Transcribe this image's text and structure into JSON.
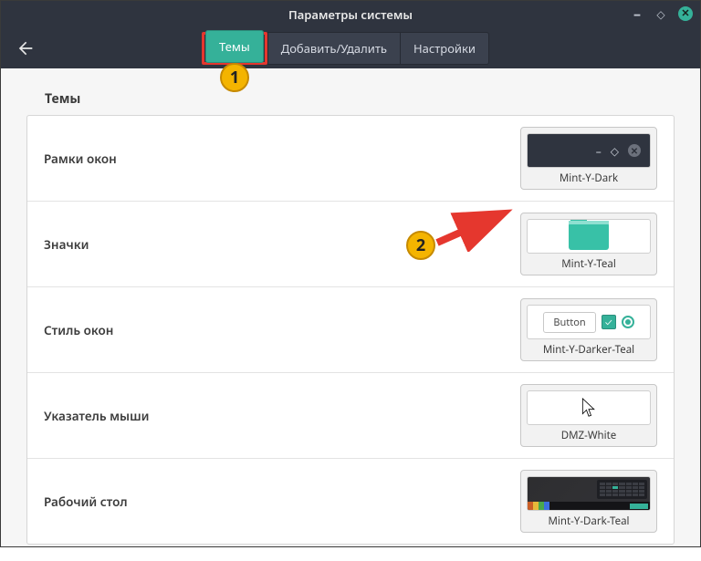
{
  "window": {
    "title": "Параметры системы"
  },
  "tabs": {
    "themes": "Темы",
    "add_remove": "Добавить/Удалить",
    "settings": "Настройки",
    "active": "themes"
  },
  "section": {
    "title": "Темы"
  },
  "rows": {
    "borders": {
      "label": "Рамки окон",
      "value": "Mint-Y-Dark"
    },
    "icons": {
      "label": "Значки",
      "value": "Mint-Y-Teal"
    },
    "controls": {
      "label": "Стиль окон",
      "value": "Mint-Y-Darker-Teal",
      "button_label": "Button"
    },
    "cursor": {
      "label": "Указатель мыши",
      "value": "DMZ-White"
    },
    "desktop": {
      "label": "Рабочий стол",
      "value": "Mint-Y-Dark-Teal"
    }
  },
  "annotations": {
    "badge1": "1",
    "badge2": "2"
  },
  "colors": {
    "accent": "#35b199",
    "titlebar": "#2f343f",
    "highlight": "#e5372e",
    "badge": "#f4b400"
  }
}
